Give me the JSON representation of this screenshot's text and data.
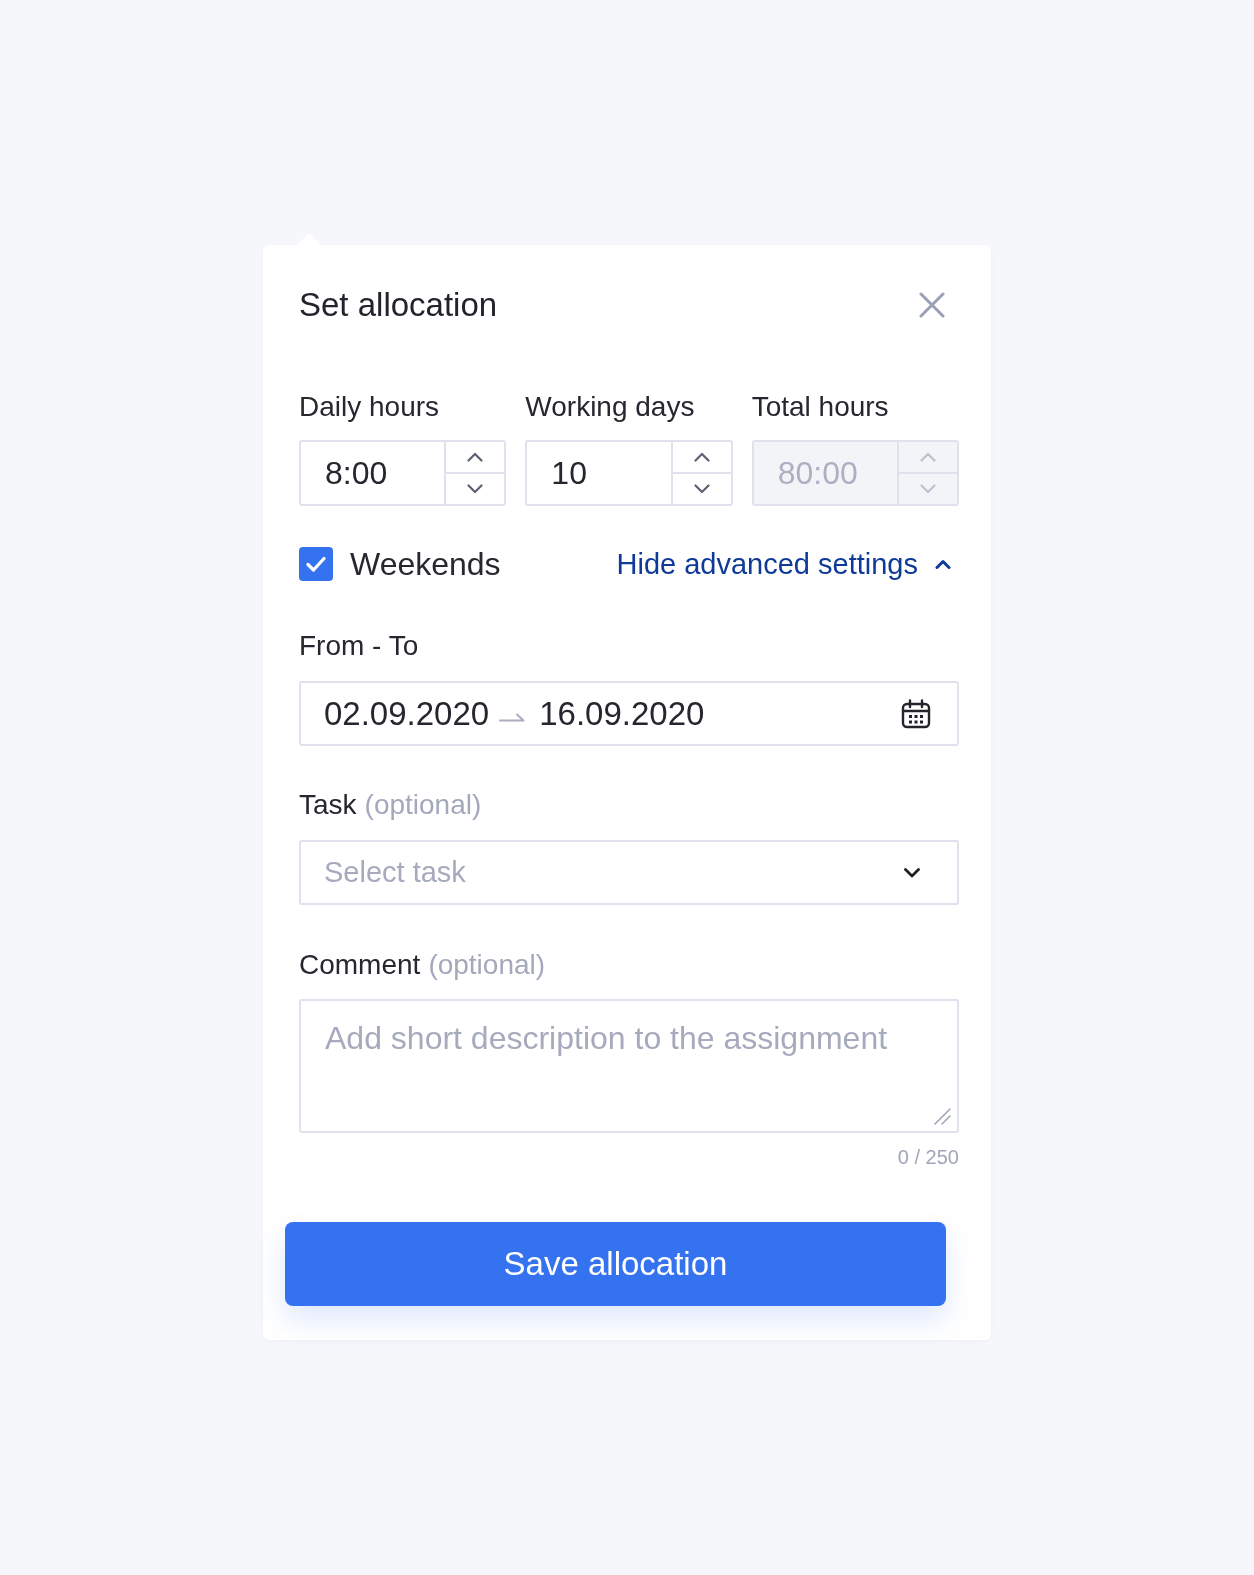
{
  "dialog": {
    "title": "Set allocation"
  },
  "number_fields": [
    {
      "label": "Daily hours",
      "value": "8:00",
      "disabled": false
    },
    {
      "label": "Working days",
      "value": "10",
      "disabled": false
    },
    {
      "label": "Total hours",
      "value": "80:00",
      "disabled": true
    }
  ],
  "weekends": {
    "label": "Weekends",
    "checked": true
  },
  "advanced_toggle": {
    "label": "Hide advanced settings",
    "expanded": true
  },
  "date_range": {
    "label": "From - To",
    "from": "02.09.2020",
    "to": "16.09.2020"
  },
  "task": {
    "label": "Task",
    "hint": "(optional)",
    "placeholder": "Select task"
  },
  "comment": {
    "label": "Comment",
    "hint": "(optional)",
    "placeholder": "Add short description to the assignment",
    "counter": "0 / 250"
  },
  "save_button": {
    "label": "Save allocation"
  }
}
